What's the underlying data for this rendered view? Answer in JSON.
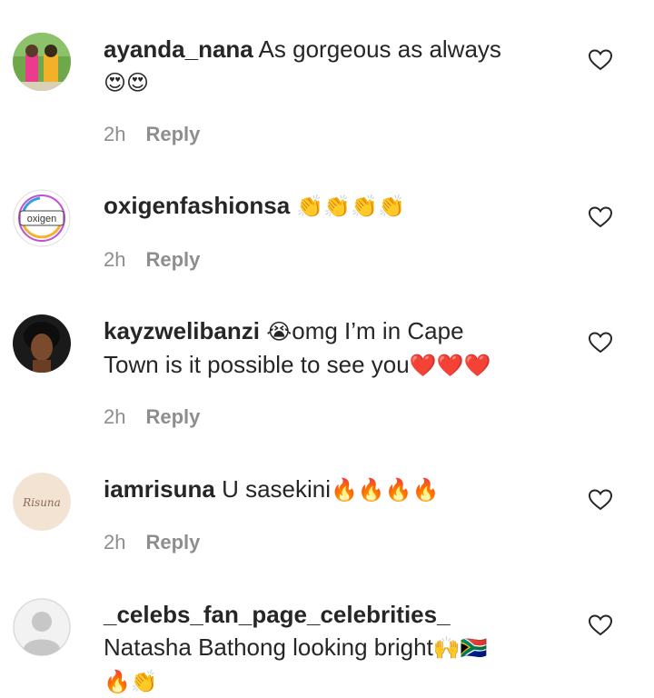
{
  "comments": [
    {
      "username": "ayanda_nana",
      "text": "As gorgeous as always",
      "emoji_line2": "😍😍",
      "time": "2h",
      "reply": "Reply"
    },
    {
      "username": "oxigenfashionsa",
      "text": "",
      "emoji_inline": "👏👏👏👏",
      "avatar_text": "oxigen",
      "time": "2h",
      "reply": "Reply"
    },
    {
      "username": "kayzwelibanzi",
      "emoji_pre": "😭",
      "text_line1": "omg I’m in Cape",
      "text_line2": "Town is it possible to see you",
      "emoji_post": "❤️❤️❤️",
      "time": "2h",
      "reply": "Reply"
    },
    {
      "username": "iamrisuna",
      "text": "U sasekini",
      "emoji_inline": "🔥🔥🔥🔥",
      "avatar_text": "Risuna",
      "time": "2h",
      "reply": "Reply"
    },
    {
      "username": "_celebs_fan_page_celebrities_",
      "text": "Natasha Bathong looking bright",
      "emoji_inline": "🙌🇿🇦",
      "emoji_line3": "🔥👏"
    }
  ],
  "icons": {
    "like": "heart-outline-icon",
    "default_avatar": "default-avatar-icon"
  },
  "colors": {
    "text": "#262626",
    "meta": "#8e8e8e",
    "heart_red": "#e0182d",
    "fire_orange": "#f58220",
    "clap_yellow": "#f7c23c"
  }
}
